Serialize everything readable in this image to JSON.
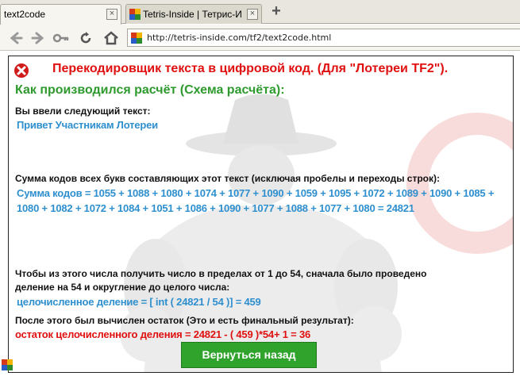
{
  "browser": {
    "tabs": [
      {
        "title": "text2code",
        "active": true
      },
      {
        "title": "Tetris-Inside | Тетрис-И...",
        "active": false
      }
    ],
    "close_symbol": "×",
    "new_tab_symbol": "+",
    "nav": {
      "back_icon": "arrow-left-icon",
      "forward_icon": "arrow-right-icon",
      "key_icon": "key-icon",
      "reload_icon": "reload-icon",
      "home_icon": "home-icon"
    },
    "url": "http://tetris-inside.com/tf2/text2code.html"
  },
  "page": {
    "title": "Перекодировщик текста в цифровой код. (Для \"Лотереи TF2\").",
    "subtitle": "Как производился расчёт (Схема расчёта):",
    "input_label": "Вы ввели следующий текст:",
    "input_text": "Привет Участникам Лотереи",
    "sum_label": "Сумма кодов всех букв составляющих этот текст (исключая пробелы и переходы строк):",
    "sum_line1": "Сумма кодов = 1055 + 1088 + 1080 + 1074 + 1077 + 1090 + 1059 + 1095 + 1072 + 1089 + 1090 + 1085 +",
    "sum_line2": "1080 + 1082 + 1072 + 1084 + 1051 + 1086 + 1090 + 1077 + 1088 + 1077 + 1080 = 24821",
    "div_label_line1": "Чтобы из этого числа получить число в пределах от 1 до 54, сначала было проведено",
    "div_label_line2": "деление на 54 и округление до целого числа:",
    "div_result": "целочисленное деление = [ int ( 24821 / 54 )] = 459",
    "rem_label": "После этого был вычислен остаток (Это и есть финальный результат):",
    "rem_result": "остаток целочисленного деления = 24821 - ( 459 )*54+ 1 = 36",
    "back_button": "Вернуться назад"
  },
  "colors": {
    "title_red": "#e01010",
    "subtitle_green": "#2e9a2e",
    "value_blue": "#2e8fcf",
    "button_green": "#2fa32c"
  }
}
